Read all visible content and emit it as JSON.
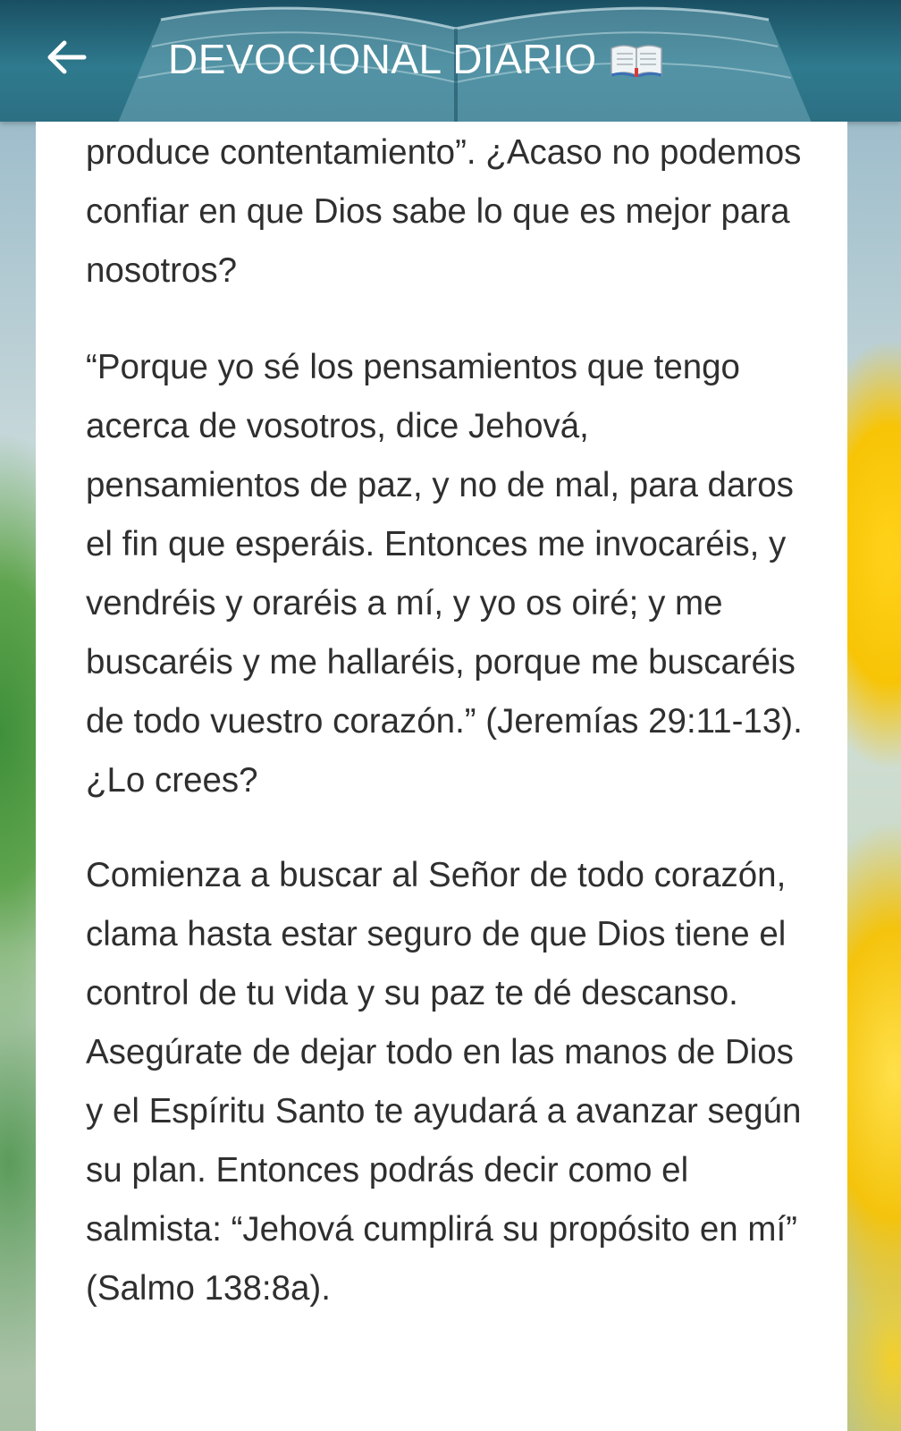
{
  "header": {
    "title": "DEVOCIONAL DIARIO",
    "back_icon": "arrow-left-icon",
    "title_icon": "open-book-icon"
  },
  "content": {
    "paragraphs": [
      "produce contentamiento”. ¿Acaso no podemos confiar en que Dios sabe lo que es mejor para nosotros?",
      "“Porque yo sé los pensamientos que tengo acerca de vosotros, dice Jehová, pensamientos de paz, y no de mal, para daros el fin que esperáis. Entonces me invocaréis, y vendréis y oraréis a mí, y yo os oiré; y me buscaréis y me hallaréis, porque me buscaréis de todo vuestro corazón.” (Jeremías 29:11-13). ¿Lo crees?",
      "Comienza a buscar al Señor de todo corazón, clama hasta estar seguro de que Dios tiene el control de tu vida y su paz te dé descanso. Asegúrate de dejar todo en las manos de Dios y el Espíritu Santo te ayudará a avanzar según su plan. Entonces podrás decir como el salmista: “Jehová cumplirá su propósito en mí” (Salmo 138:8a)."
    ]
  },
  "colors": {
    "header_bg": "#2c6f83",
    "header_text": "#ffffff",
    "body_text": "#2f2f2f",
    "card_bg": "#ffffff"
  }
}
